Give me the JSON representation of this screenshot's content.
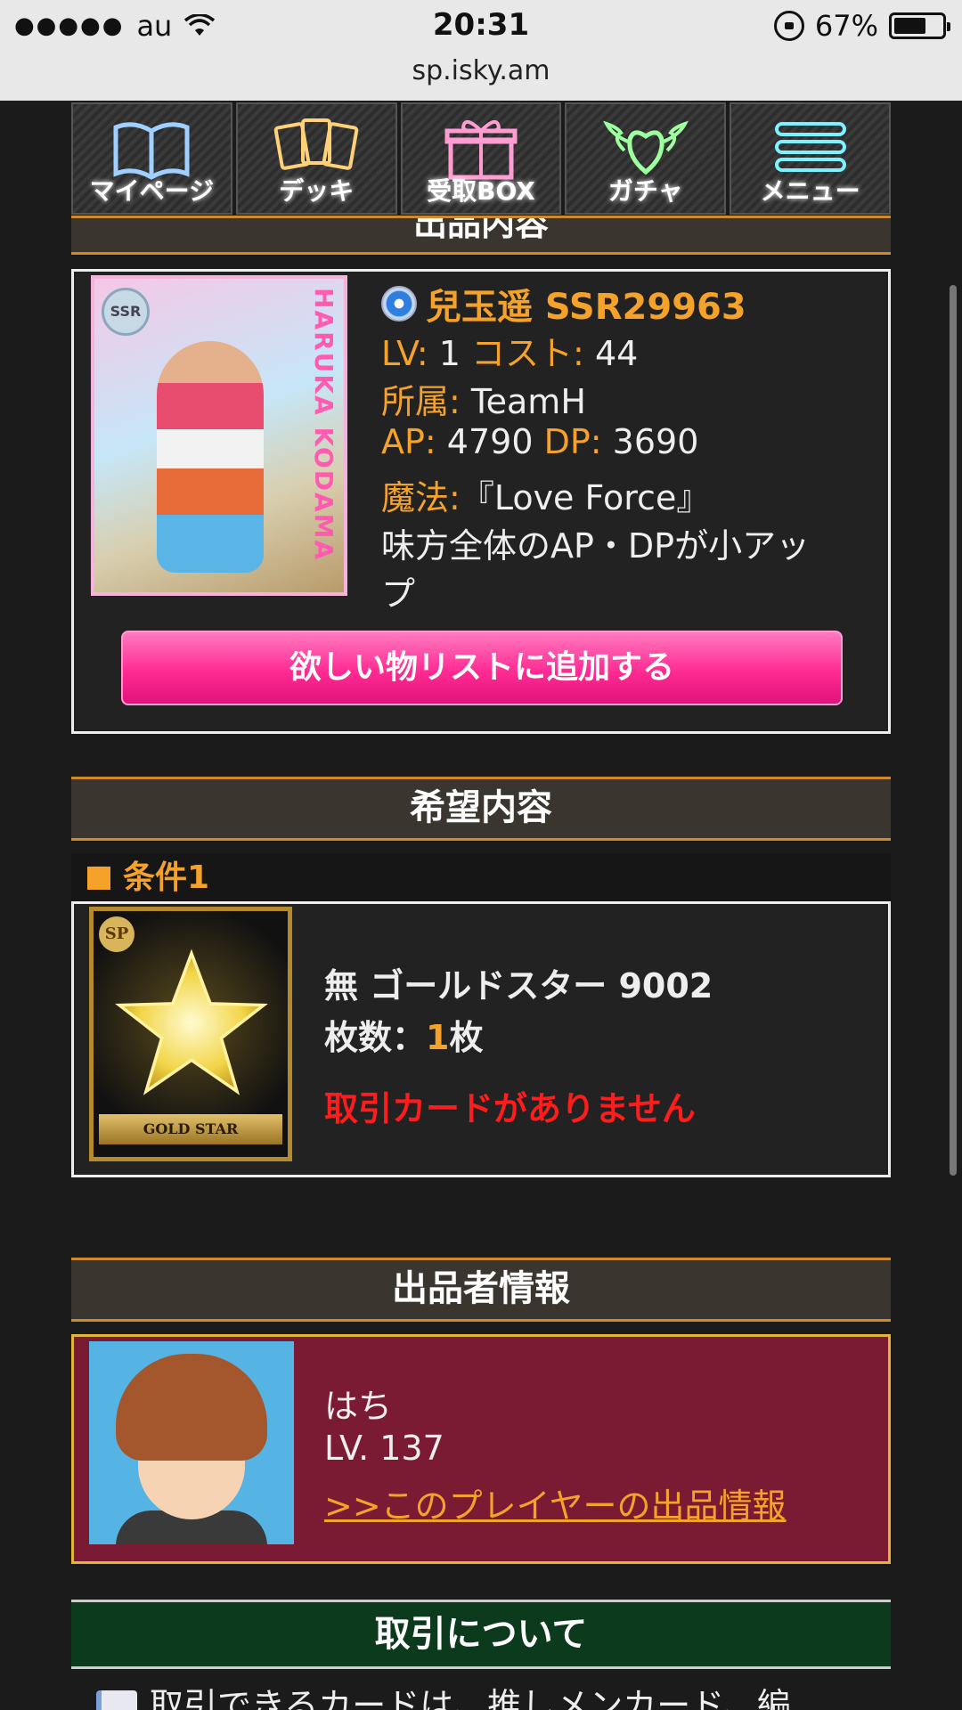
{
  "status_bar": {
    "signal": "●●●●●",
    "carrier": "au",
    "time": "20:31",
    "battery_pct": "67%",
    "battery_level": 0.67
  },
  "browser": {
    "url": "sp.isky.am"
  },
  "nav": [
    {
      "label": "マイページ",
      "icon": "open-book-icon",
      "color": "#9fd0ff"
    },
    {
      "label": "デッキ",
      "icon": "cards-icon",
      "color": "#ffd27a"
    },
    {
      "label": "受取BOX",
      "icon": "gift-box-icon",
      "color": "#ff9cd2"
    },
    {
      "label": "ガチャ",
      "icon": "winged-heart-icon",
      "color": "#9dff9d"
    },
    {
      "label": "メニュー",
      "icon": "menu-lines-icon",
      "color": "#7df2ff"
    }
  ],
  "listing": {
    "section_title": "出品内容",
    "card_badge": "SSR",
    "card_art_text": "HARUKA KODAMA",
    "name": "兒玉遥 SSR29963",
    "lv_key": "LV:",
    "lv_val": " 1 ",
    "cost_key": "コスト:",
    "cost_val": " 44",
    "team_key": "所属:",
    "team_val": " TeamH",
    "ap_key": "AP:",
    "ap_val": " 4790 ",
    "dp_key": "DP:",
    "dp_val": " 3690",
    "magic_key": "魔法:",
    "magic_val": "『Love Force』",
    "effect_line1": "味方全体のAP・DPが小アッ",
    "effect_line2": "プ",
    "add_button": "欲しい物リストに追加する"
  },
  "wanted": {
    "section_title": "希望内容",
    "condition": "条件1",
    "card_badge": "SP",
    "card_ribbon": "GOLD STAR",
    "item_name": "無 ゴールドスター 9002",
    "qty_prefix": "枚数：",
    "qty_value": "1",
    "qty_suffix": "枚",
    "notice": "取引カードがありません"
  },
  "seller": {
    "section_title": "出品者情報",
    "name": "はち",
    "level": "LV. 137",
    "link": ">>このプレイヤーの出品情報"
  },
  "about": {
    "section_title": "取引について",
    "text": "取引できるカードは、推しメンカード、編"
  }
}
